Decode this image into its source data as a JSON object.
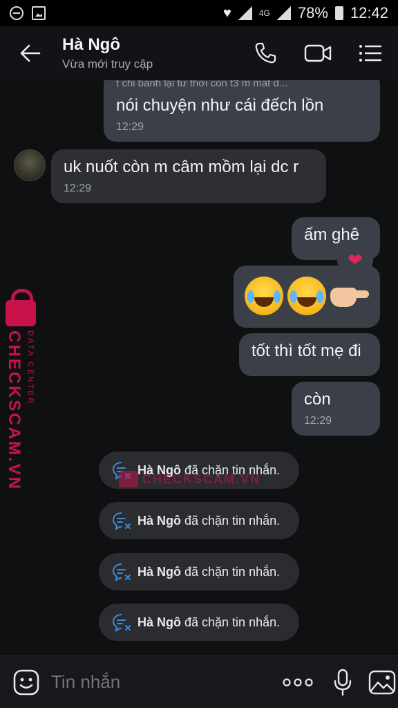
{
  "status_bar": {
    "network_label": "4G",
    "battery_percent": "78%",
    "time": "12:42"
  },
  "header": {
    "contact_name": "Hà Ngô",
    "status": "Vừa mới truy cập"
  },
  "messages": [
    {
      "direction": "out",
      "quote": "t chỉ bảnh lại từ thời còn t3 m mất d...",
      "text": "nói chuyện như cái đếch lồn",
      "time": "12:29"
    },
    {
      "direction": "in",
      "text": "uk nuốt còn m câm mồm lại dc r",
      "time": "12:29"
    },
    {
      "direction": "out",
      "text": "ấm ghê",
      "reaction": "heart"
    },
    {
      "direction": "out",
      "type": "emoji",
      "emojis": [
        "face-with-tears-of-joy",
        "face-with-tears-of-joy",
        "backhand-index-pointing-right"
      ]
    },
    {
      "direction": "out",
      "text": "tốt thì tốt mẹ đi"
    },
    {
      "direction": "out",
      "text": "còn",
      "time": "12:29"
    }
  ],
  "notices": [
    {
      "name": "Hà Ngô",
      "text": "đã chặn tin nhắn."
    },
    {
      "name": "Hà Ngô",
      "text": "đã chặn tin nhắn."
    },
    {
      "name": "Hà Ngô",
      "text": "đã chặn tin nhắn."
    },
    {
      "name": "Hà Ngô",
      "text": "đã chặn tin nhắn."
    }
  ],
  "watermark": {
    "brand": "CHECKSCAM.VN",
    "sub": "DATA CENTER",
    "color": "#c7134a"
  },
  "composer": {
    "placeholder": "Tin nhắn"
  }
}
